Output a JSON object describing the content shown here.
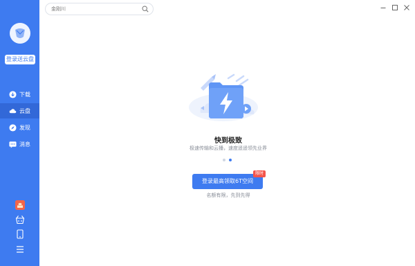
{
  "search": {
    "placeholder": "金刚川"
  },
  "sidebar": {
    "login_label": "登录送云盘",
    "items": [
      {
        "label": "下载",
        "icon": "download-icon",
        "active": false
      },
      {
        "label": "云盘",
        "icon": "cloud-icon",
        "active": true
      },
      {
        "label": "发现",
        "icon": "compass-icon",
        "active": false
      },
      {
        "label": "消息",
        "icon": "message-icon",
        "active": false
      }
    ],
    "bottom_icons": [
      "gift-icon",
      "crown-basket-icon",
      "tablet-icon",
      "menu-icon"
    ]
  },
  "window_controls": [
    "minimize-icon",
    "maximize-icon",
    "close-icon"
  ],
  "main": {
    "title": "快到极致",
    "subtitle": "极速传输和云播，速度遥遥领先业界",
    "carousel": {
      "count": 2,
      "active_index": 1
    },
    "cta_label": "登录最高领取6T空间",
    "badge": "限时",
    "note": "名额有限，先到先得"
  },
  "colors": {
    "accent": "#3e7bf0",
    "sidebar": "#3e7bf0",
    "badge": "#f4554c"
  }
}
